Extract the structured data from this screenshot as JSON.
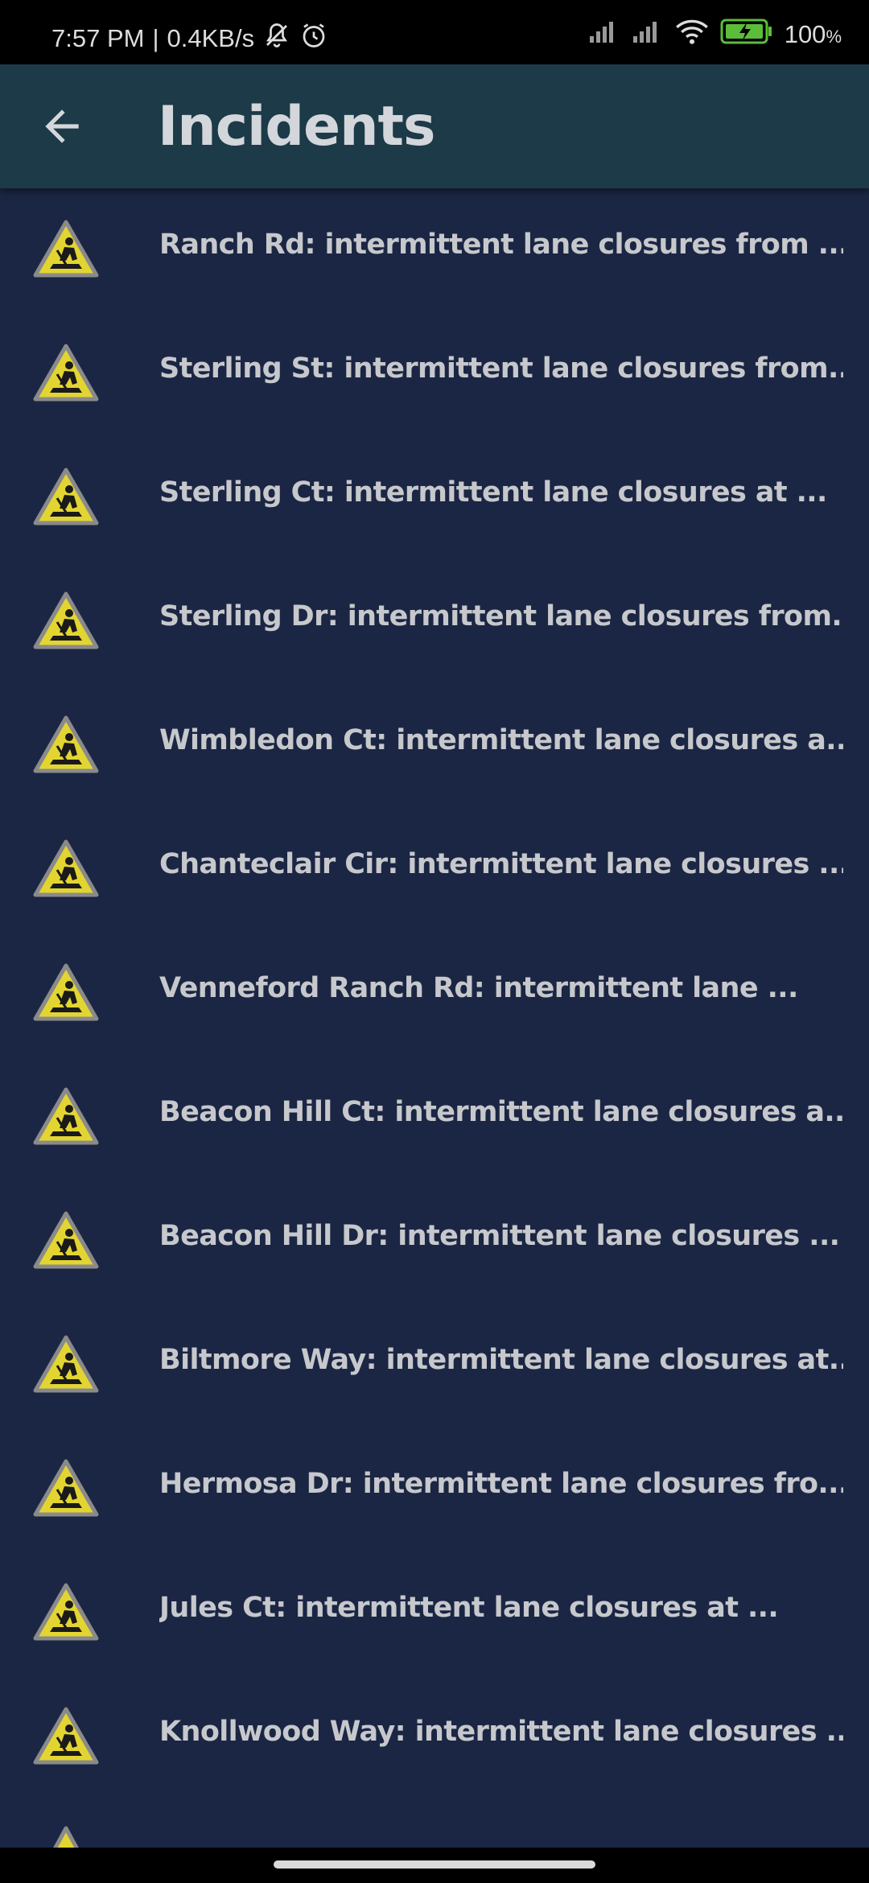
{
  "status_bar": {
    "time": "7:57 PM",
    "separator": "|",
    "network_speed": "0.4KB/s",
    "battery_percent": "100",
    "battery_unit": "%",
    "icons": [
      "mute-icon",
      "alarm-icon",
      "signal-icon",
      "signal-icon",
      "wifi-icon",
      "battery-charging-icon"
    ]
  },
  "app_bar": {
    "title": "Incidents",
    "back_icon": "arrow-back-icon"
  },
  "colors": {
    "background": "#1b2644",
    "app_bar": "#1c3a48",
    "text": "#c6c8cc",
    "icon_yellow": "#e3d531"
  },
  "incidents": [
    {
      "label": "Ranch Rd: intermittent lane closures from ...",
      "icon": "road-work-icon"
    },
    {
      "label": "Sterling St: intermittent lane closures from...",
      "icon": "road-work-icon"
    },
    {
      "label": "Sterling Ct: intermittent lane closures at ...",
      "icon": "road-work-icon"
    },
    {
      "label": "Sterling Dr: intermittent lane closures from...",
      "icon": "road-work-icon"
    },
    {
      "label": "Wimbledon Ct: intermittent lane closures a...",
      "icon": "road-work-icon"
    },
    {
      "label": "Chanteclair Cir: intermittent lane closures ...",
      "icon": "road-work-icon"
    },
    {
      "label": "Venneford Ranch Rd: intermittent lane ...",
      "icon": "road-work-icon"
    },
    {
      "label": "Beacon Hill Ct: intermittent lane closures a...",
      "icon": "road-work-icon"
    },
    {
      "label": "Beacon Hill Dr: intermittent lane closures ...",
      "icon": "road-work-icon"
    },
    {
      "label": "Biltmore Way: intermittent lane closures at...",
      "icon": "road-work-icon"
    },
    {
      "label": "Hermosa Dr: intermittent lane closures fro...",
      "icon": "road-work-icon"
    },
    {
      "label": "Jules Ct: intermittent lane closures at ...",
      "icon": "road-work-icon"
    },
    {
      "label": "Knollwood Way: intermittent lane closures ...",
      "icon": "road-work-icon"
    }
  ]
}
